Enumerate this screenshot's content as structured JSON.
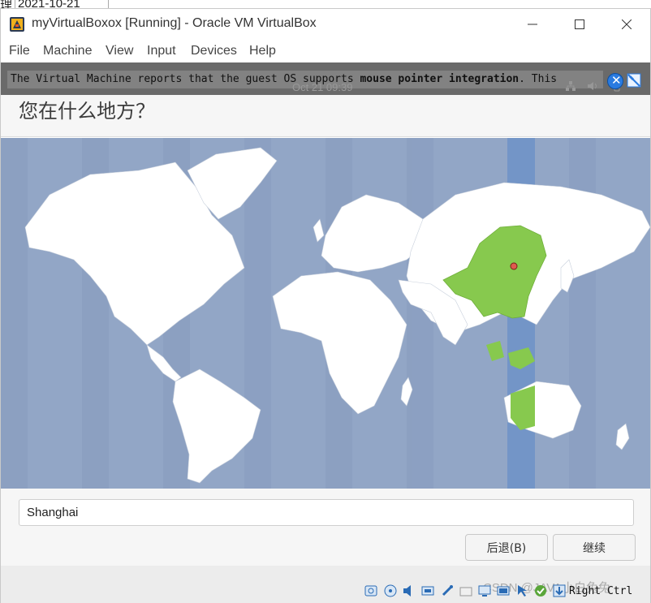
{
  "background": {
    "left_char": "理",
    "date": "2021-10-21"
  },
  "window": {
    "title": "myVirtualBoxox [Running] - Oracle VM VirtualBox"
  },
  "menu": {
    "items": [
      "File",
      "Machine",
      "View",
      "Input",
      "Devices",
      "Help"
    ]
  },
  "notice": {
    "text_before": "The Virtual Machine reports that the guest OS supports ",
    "text_bold": "mouse pointer integration",
    "text_after": ". This"
  },
  "guest_topbar": {
    "clock": "Oct 21  09:39"
  },
  "installer": {
    "title": "您在什么地方？",
    "timezone_value": "Shanghai",
    "back_label": "后退(B)",
    "continue_label": "继续"
  },
  "map": {
    "selected_region": "Asia/Shanghai",
    "ocean_color": "#92a6c6",
    "land_color": "#ffffff",
    "highlight_color": "#87c94e",
    "timezone_band_color": "#7395c7"
  },
  "statusbar": {
    "watermark": "CSDN @JAVA小白兔兔",
    "host_key": "Right Ctrl"
  },
  "icons": {
    "app": "virtualbox-app-icon",
    "minimize": "minimize-icon",
    "maximize": "maximize-icon",
    "close": "close-icon",
    "notice_close": "notice-close-icon",
    "notice_mute": "notice-mute-icon",
    "statusbar": [
      "hard-disk-icon",
      "optical-drive-icon",
      "audio-icon",
      "network-icon",
      "usb-icon",
      "shared-folder-icon",
      "display-icon",
      "video-capture-icon",
      "mouse-integration-icon",
      "keyboard-capture-icon"
    ]
  }
}
